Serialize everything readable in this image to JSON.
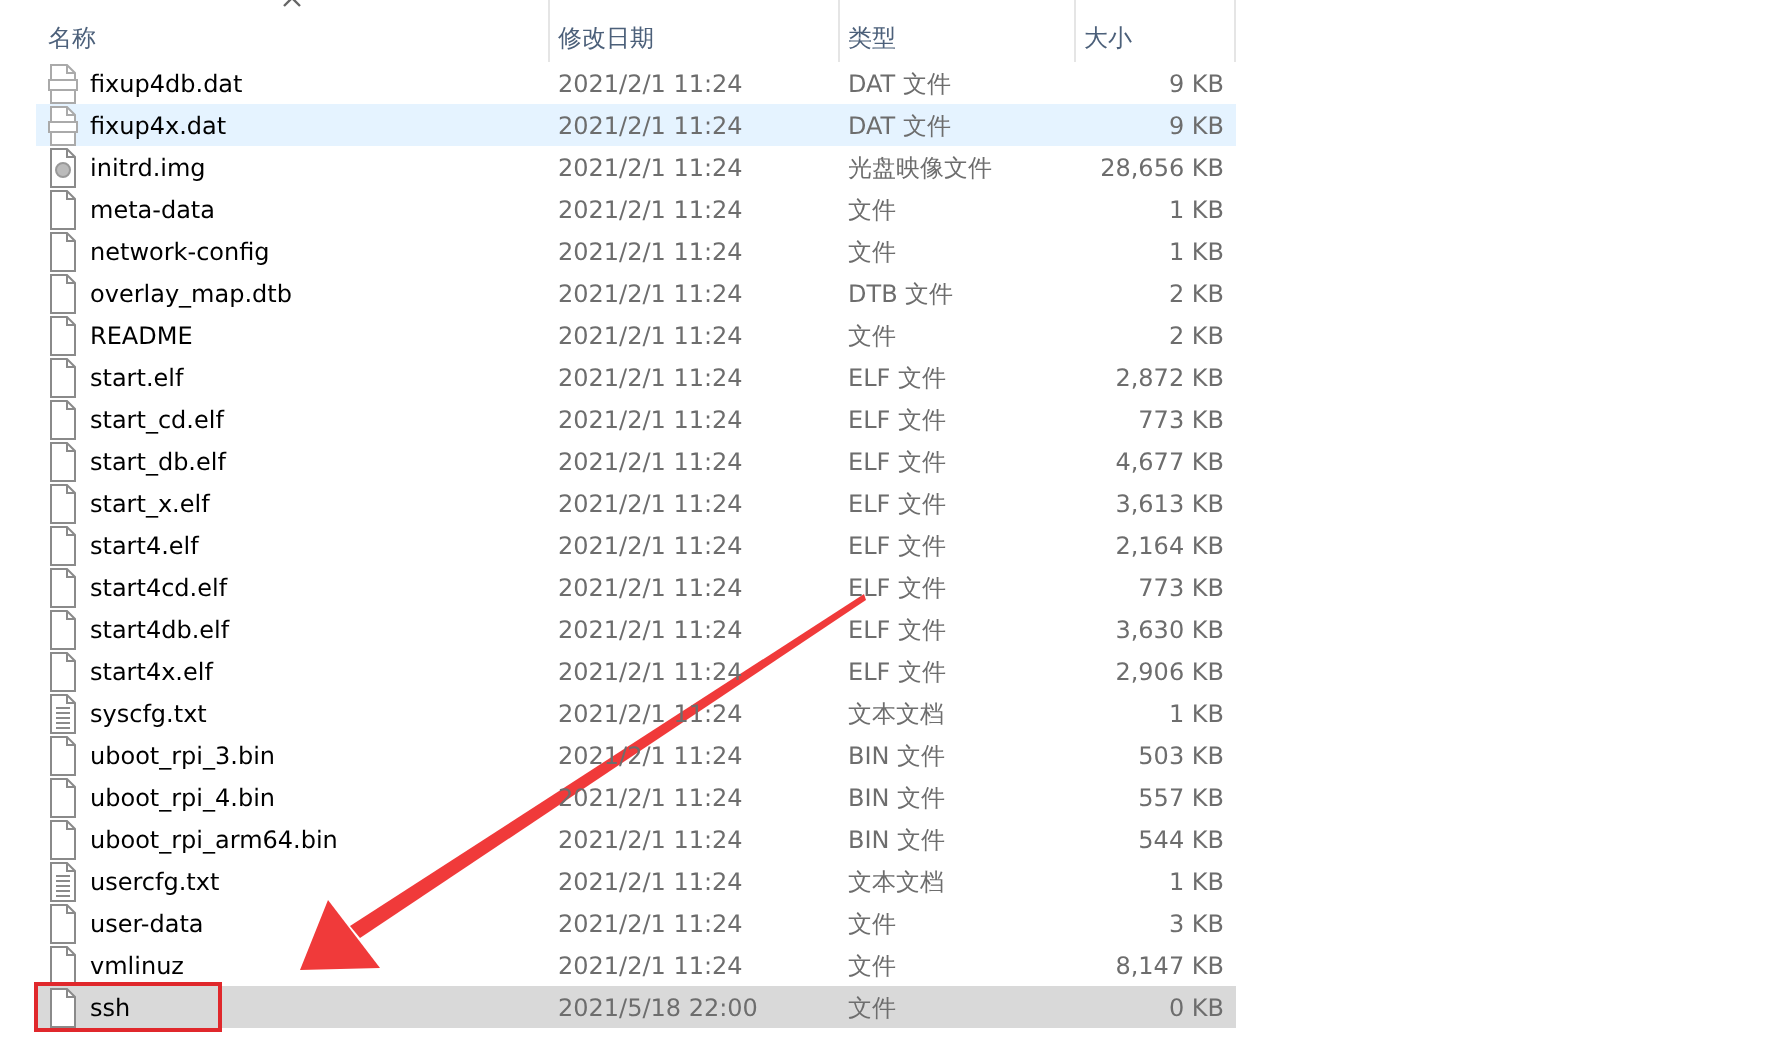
{
  "columns": [
    {
      "label": "名称",
      "sorted": true
    },
    {
      "label": "修改日期",
      "sorted": false
    },
    {
      "label": "类型",
      "sorted": false
    },
    {
      "label": "大小",
      "sorted": false
    }
  ],
  "files": [
    {
      "name": "fixup4db.dat",
      "date": "2021/2/1 11:24",
      "type": "DAT 文件",
      "size": "9 KB",
      "kind": "vcd",
      "hovered": false,
      "selected": false,
      "annotated": false
    },
    {
      "name": "fixup4x.dat",
      "date": "2021/2/1 11:24",
      "type": "DAT 文件",
      "size": "9 KB",
      "kind": "vcd",
      "hovered": true,
      "selected": false,
      "annotated": false
    },
    {
      "name": "initrd.img",
      "date": "2021/2/1 11:24",
      "type": "光盘映像文件",
      "size": "28,656 KB",
      "kind": "disc",
      "hovered": false,
      "selected": false,
      "annotated": false
    },
    {
      "name": "meta-data",
      "date": "2021/2/1 11:24",
      "type": "文件",
      "size": "1 KB",
      "kind": "file",
      "hovered": false,
      "selected": false,
      "annotated": false
    },
    {
      "name": "network-config",
      "date": "2021/2/1 11:24",
      "type": "文件",
      "size": "1 KB",
      "kind": "file",
      "hovered": false,
      "selected": false,
      "annotated": false
    },
    {
      "name": "overlay_map.dtb",
      "date": "2021/2/1 11:24",
      "type": "DTB 文件",
      "size": "2 KB",
      "kind": "file",
      "hovered": false,
      "selected": false,
      "annotated": false
    },
    {
      "name": "README",
      "date": "2021/2/1 11:24",
      "type": "文件",
      "size": "2 KB",
      "kind": "file",
      "hovered": false,
      "selected": false,
      "annotated": false
    },
    {
      "name": "start.elf",
      "date": "2021/2/1 11:24",
      "type": "ELF 文件",
      "size": "2,872 KB",
      "kind": "file",
      "hovered": false,
      "selected": false,
      "annotated": false
    },
    {
      "name": "start_cd.elf",
      "date": "2021/2/1 11:24",
      "type": "ELF 文件",
      "size": "773 KB",
      "kind": "file",
      "hovered": false,
      "selected": false,
      "annotated": false
    },
    {
      "name": "start_db.elf",
      "date": "2021/2/1 11:24",
      "type": "ELF 文件",
      "size": "4,677 KB",
      "kind": "file",
      "hovered": false,
      "selected": false,
      "annotated": false
    },
    {
      "name": "start_x.elf",
      "date": "2021/2/1 11:24",
      "type": "ELF 文件",
      "size": "3,613 KB",
      "kind": "file",
      "hovered": false,
      "selected": false,
      "annotated": false
    },
    {
      "name": "start4.elf",
      "date": "2021/2/1 11:24",
      "type": "ELF 文件",
      "size": "2,164 KB",
      "kind": "file",
      "hovered": false,
      "selected": false,
      "annotated": false
    },
    {
      "name": "start4cd.elf",
      "date": "2021/2/1 11:24",
      "type": "ELF 文件",
      "size": "773 KB",
      "kind": "file",
      "hovered": false,
      "selected": false,
      "annotated": false
    },
    {
      "name": "start4db.elf",
      "date": "2021/2/1 11:24",
      "type": "ELF 文件",
      "size": "3,630 KB",
      "kind": "file",
      "hovered": false,
      "selected": false,
      "annotated": false
    },
    {
      "name": "start4x.elf",
      "date": "2021/2/1 11:24",
      "type": "ELF 文件",
      "size": "2,906 KB",
      "kind": "file",
      "hovered": false,
      "selected": false,
      "annotated": false
    },
    {
      "name": "syscfg.txt",
      "date": "2021/2/1 11:24",
      "type": "文本文档",
      "size": "1 KB",
      "kind": "text",
      "hovered": false,
      "selected": false,
      "annotated": false
    },
    {
      "name": "uboot_rpi_3.bin",
      "date": "2021/2/1 11:24",
      "type": "BIN 文件",
      "size": "503 KB",
      "kind": "file",
      "hovered": false,
      "selected": false,
      "annotated": false
    },
    {
      "name": "uboot_rpi_4.bin",
      "date": "2021/2/1 11:24",
      "type": "BIN 文件",
      "size": "557 KB",
      "kind": "file",
      "hovered": false,
      "selected": false,
      "annotated": false
    },
    {
      "name": "uboot_rpi_arm64.bin",
      "date": "2021/2/1 11:24",
      "type": "BIN 文件",
      "size": "544 KB",
      "kind": "file",
      "hovered": false,
      "selected": false,
      "annotated": false
    },
    {
      "name": "usercfg.txt",
      "date": "2021/2/1 11:24",
      "type": "文本文档",
      "size": "1 KB",
      "kind": "text",
      "hovered": false,
      "selected": false,
      "annotated": false
    },
    {
      "name": "user-data",
      "date": "2021/2/1 11:24",
      "type": "文件",
      "size": "3 KB",
      "kind": "file",
      "hovered": false,
      "selected": false,
      "annotated": false
    },
    {
      "name": "vmlinuz",
      "date": "2021/2/1 11:24",
      "type": "文件",
      "size": "8,147 KB",
      "kind": "file",
      "hovered": false,
      "selected": false,
      "annotated": false
    },
    {
      "name": "ssh",
      "date": "2021/5/18 22:00",
      "type": "文件",
      "size": "0 KB",
      "kind": "file",
      "hovered": false,
      "selected": true,
      "annotated": true
    }
  ]
}
